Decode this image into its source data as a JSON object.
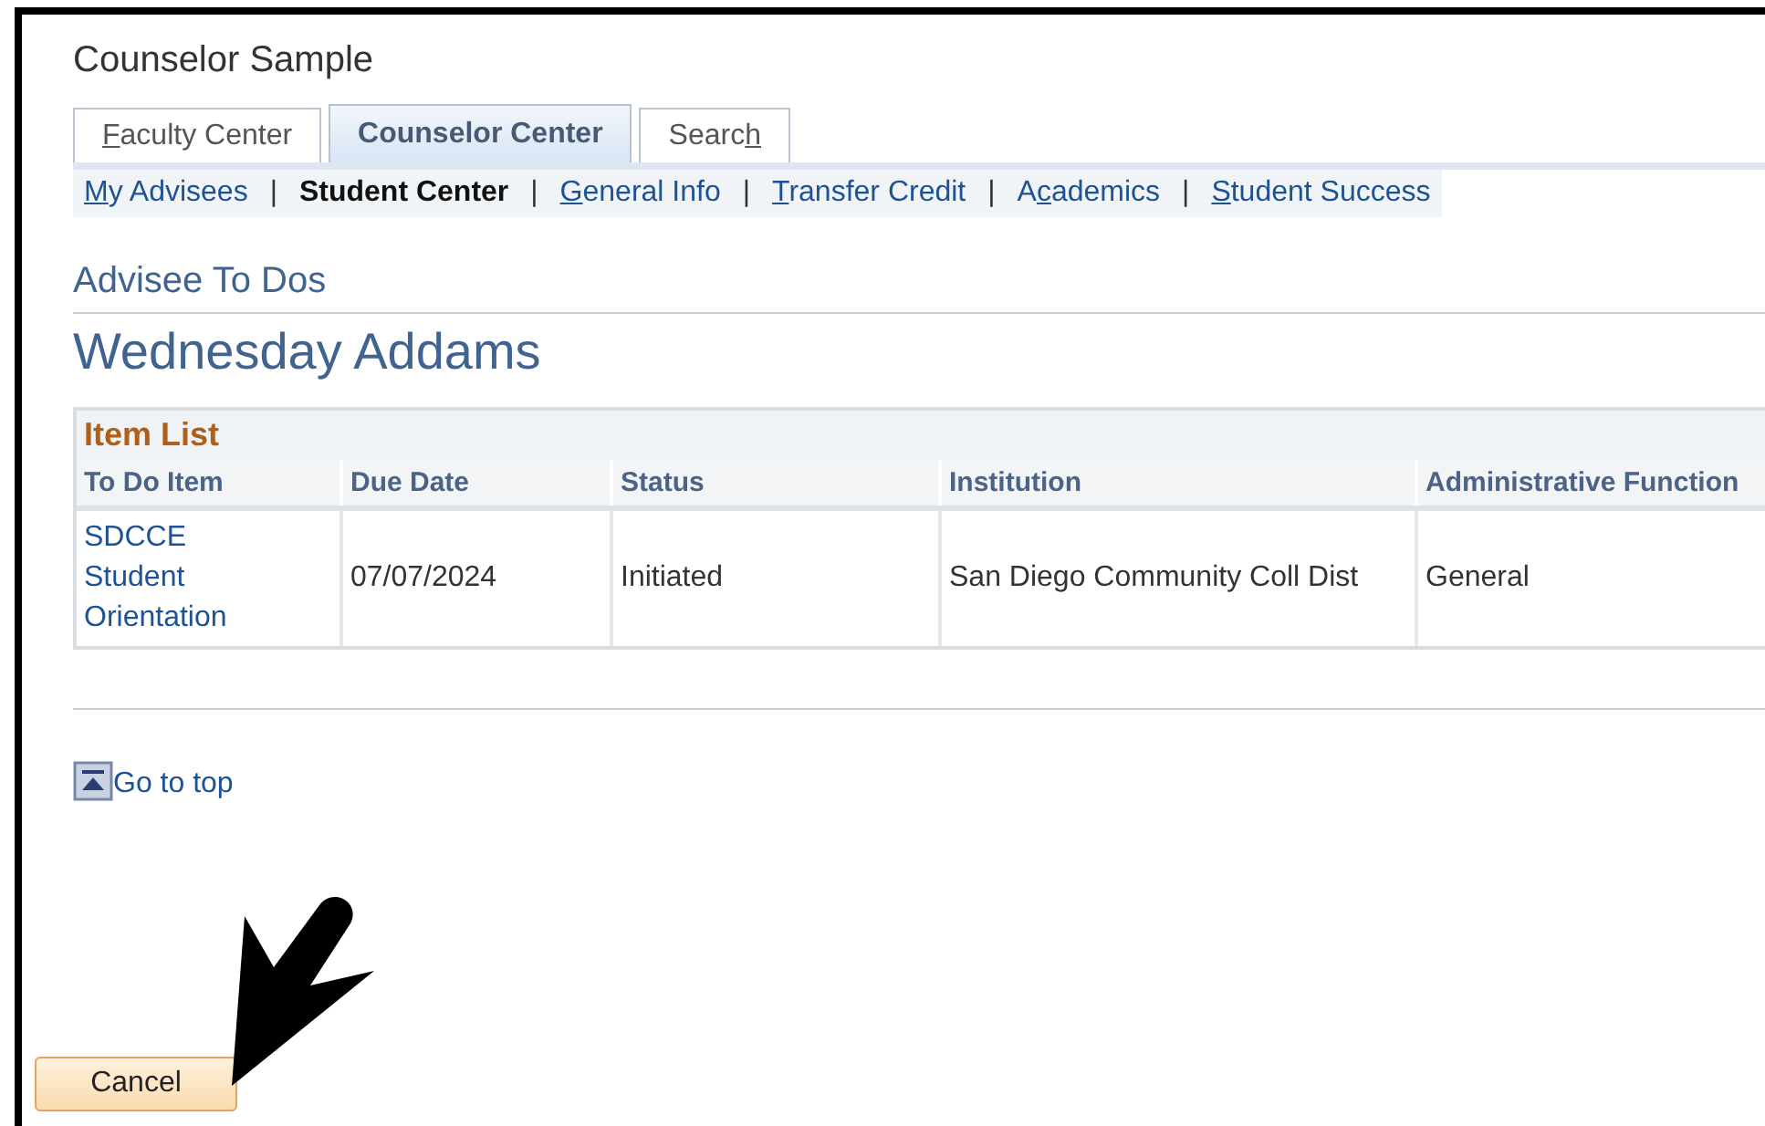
{
  "page_title": "Counselor Sample",
  "tabs": [
    {
      "key": "F",
      "after": "aculty Center",
      "selected": false
    },
    {
      "before": "Counselor Center",
      "selected": true
    },
    {
      "before": "Searc",
      "key": "h",
      "selected": false
    }
  ],
  "subnav": [
    {
      "key": "M",
      "after": "y Advisees",
      "selected": false
    },
    {
      "before": "Student Center",
      "selected": true
    },
    {
      "key": "G",
      "after": "eneral Info",
      "selected": false
    },
    {
      "key": "T",
      "after": "ransfer Credit",
      "selected": false
    },
    {
      "before": "A",
      "key": "c",
      "after": "ademics",
      "selected": false
    },
    {
      "key": "S",
      "after": "tudent Success",
      "selected": false
    }
  ],
  "separator": "|",
  "section_title": "Advisee To Dos",
  "student_name": "Wednesday Addams",
  "grid": {
    "title": "Item List",
    "columns": [
      "To Do Item",
      "Due Date",
      "Status",
      "Institution",
      "Administrative Function"
    ],
    "rows": [
      {
        "item": "SDCCE Student Orientation",
        "due_date": "07/07/2024",
        "status": "Initiated",
        "institution": "San Diego Community Coll Dist",
        "function": "General"
      }
    ]
  },
  "go_to_top": "Go to top",
  "cancel_button": "Cancel"
}
